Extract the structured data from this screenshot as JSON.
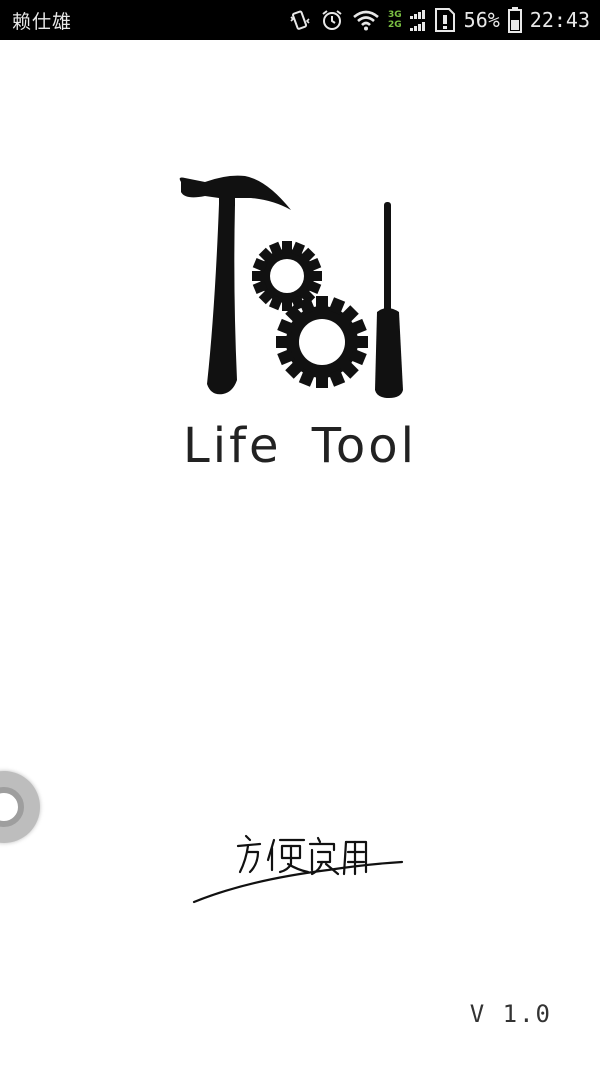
{
  "status_bar": {
    "carrier": "赖仕雄",
    "network_top": "3G",
    "network_bottom": "2G",
    "battery_percent": "56%",
    "time": "22:43",
    "icons": [
      "vibrate-icon",
      "alarm-icon",
      "wifi-icon",
      "signal-icon",
      "sim-icon",
      "battery-icon"
    ]
  },
  "splash": {
    "app_name": "Life Tool",
    "version": "V 1.0",
    "logo_icons": [
      "hammer-icon",
      "gear-icon",
      "screwdriver-icon"
    ]
  },
  "colors": {
    "status_bar_bg": "#000000",
    "background": "#ffffff",
    "logo": "#111111",
    "network_label": "#7bc043"
  }
}
